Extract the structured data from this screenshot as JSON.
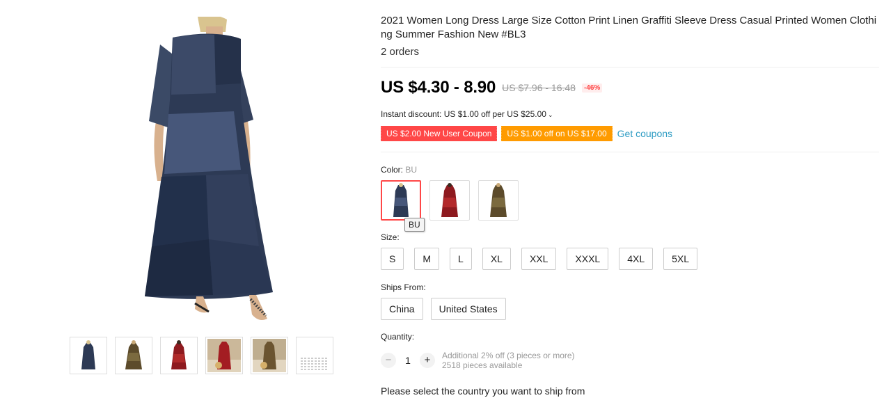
{
  "product": {
    "title": "2021 Women Long Dress Large Size Cotton Print Linen Graffiti Sleeve Dress Casual Printed Women Clothing Summer Fashion New #BL3",
    "orders": "2 orders"
  },
  "price": {
    "current": "US $4.30 - 8.90",
    "original": "US $7.96 - 16.48",
    "discount": "-46%"
  },
  "instant_discount": {
    "text": "Instant discount: US $1.00 off per US $25.00",
    "chevron": "⌄"
  },
  "coupons": {
    "new_user": "US $2.00 New User Coupon",
    "off": "US $1.00 off on US $17.00",
    "get_label": "Get coupons"
  },
  "color": {
    "label": "Color:",
    "selected": "BU",
    "tooltip": "BU",
    "options": [
      {
        "name": "BU",
        "color": "#2d3a55"
      },
      {
        "name": "RD",
        "color": "#8e1a1f"
      },
      {
        "name": "BR",
        "color": "#5c4b2b"
      }
    ]
  },
  "size": {
    "label": "Size:",
    "options": [
      "S",
      "M",
      "L",
      "XL",
      "XXL",
      "XXXL",
      "4XL",
      "5XL"
    ]
  },
  "ships_from": {
    "label": "Ships From:",
    "options": [
      "China",
      "United States"
    ]
  },
  "quantity": {
    "label": "Quantity:",
    "minus": "−",
    "value": "1",
    "plus": "+",
    "note_discount": "Additional 2% off (3 pieces or more)",
    "note_available": "2518 pieces available"
  },
  "ship_message": "Please select the country you want to ship from",
  "thumbnails": [
    {
      "icon": "dress-blue-thumb",
      "color": "#2d3a55"
    },
    {
      "icon": "dress-brown-thumb",
      "color": "#5c4b2b"
    },
    {
      "icon": "dress-red-thumb",
      "color": "#8e1a1f"
    },
    {
      "icon": "dress-red-beach-thumb",
      "color": "#a31d22"
    },
    {
      "icon": "dress-brown-beach-thumb",
      "color": "#6b5430"
    },
    {
      "icon": "size-chart-thumb",
      "color": "#cccccc"
    }
  ],
  "colors": {
    "accent_red": "#ff4747",
    "coupon_orange": "#ff9b00",
    "link_blue": "#2e9cc3"
  }
}
